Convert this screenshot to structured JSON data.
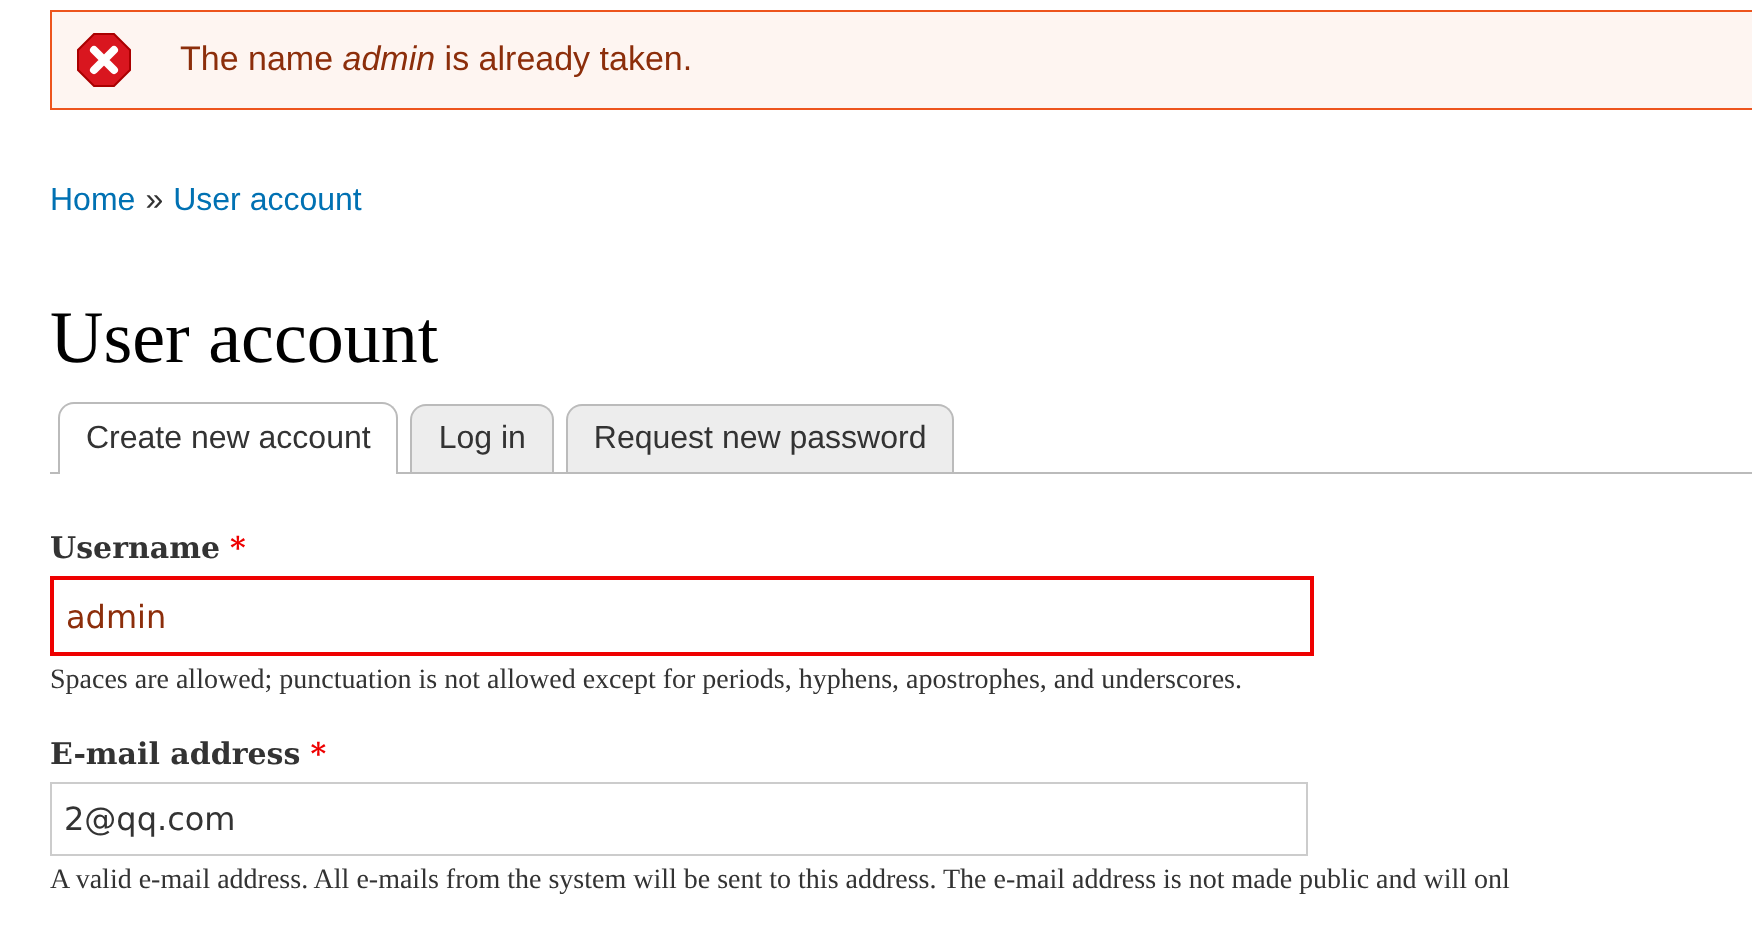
{
  "message": {
    "kind": "error",
    "text": "The name *admin* is already taken."
  },
  "breadcrumb": [
    {
      "label": "Home"
    },
    {
      "label": "User account"
    }
  ],
  "breadcrumb_separator": "»",
  "title": "User account",
  "tabs": [
    {
      "label": "Create new account",
      "selected": true
    },
    {
      "label": "Log in",
      "selected": false
    },
    {
      "label": "Request new password",
      "selected": false
    }
  ],
  "fields": [
    {
      "label": "Username",
      "required_mark": "*",
      "value": "admin",
      "error": true,
      "description": "Spaces are allowed; punctuation is not allowed except for periods, hyphens, apostrophes, and underscores."
    },
    {
      "label": "E-mail address",
      "required_mark": "*",
      "value": "2@qq.com",
      "error": false,
      "description": "A valid e-mail address. All e-mails from the system will be sent to this address. The e-mail address is not made public and will onl"
    }
  ]
}
